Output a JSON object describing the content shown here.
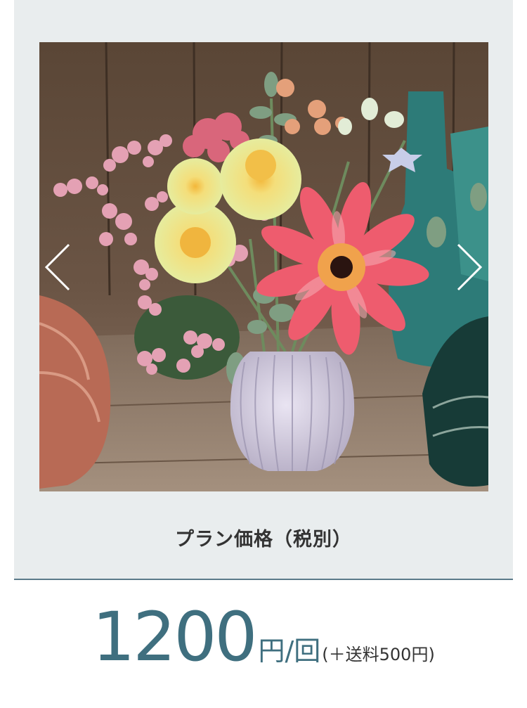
{
  "carousel": {
    "image_alt": "flower-bouquet-photo",
    "dots": [
      {
        "active": false
      },
      {
        "active": false
      },
      {
        "active": false
      },
      {
        "active": true
      },
      {
        "active": false
      }
    ]
  },
  "plan": {
    "title": "プラン価格（税別）"
  },
  "price": {
    "amount": "1200",
    "unit": "円/回",
    "shipping": "(＋送料500円)"
  },
  "colors": {
    "card_background": "#e9edee",
    "accent": "#3f6f7f",
    "divider": "#5b7a8a"
  }
}
